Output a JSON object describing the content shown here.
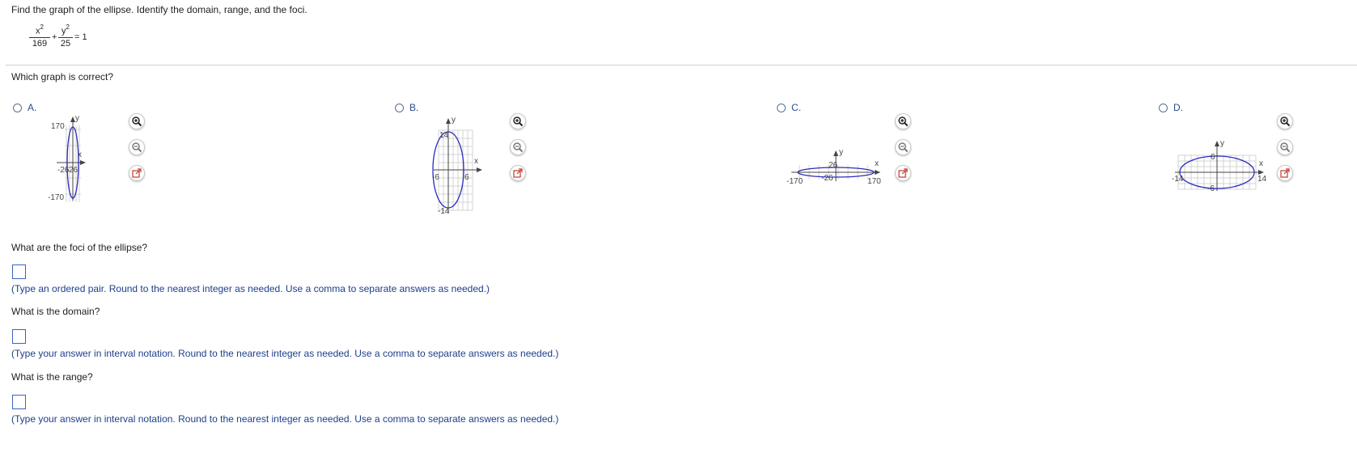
{
  "question": {
    "prompt": "Find the graph of the ellipse. Identify the domain, range, and the foci.",
    "equation": {
      "term1_num": "x",
      "term1_exp": "2",
      "term1_den": "169",
      "plus": "+",
      "term2_num": "y",
      "term2_exp": "2",
      "term2_den": "25",
      "rhs": "= 1"
    }
  },
  "graph_question": "Which graph is correct?",
  "options": [
    {
      "letter": "A.",
      "axis_x": "x",
      "axis_y": "y",
      "y_max_label": "170",
      "y_min_label": "-170",
      "x_left_label": "-26",
      "x_right_label": "26"
    },
    {
      "letter": "B.",
      "axis_x": "x",
      "axis_y": "y",
      "y_max_label": "14",
      "y_min_label": "-14",
      "x_left_label": "-6",
      "x_right_label": "6"
    },
    {
      "letter": "C.",
      "axis_x": "x",
      "axis_y": "y",
      "y_max_label": "26",
      "y_min_label": "-26",
      "x_left_label": "-170",
      "x_right_label": "170"
    },
    {
      "letter": "D.",
      "axis_x": "x",
      "axis_y": "y",
      "y_max_label": "6",
      "y_min_label": "-6",
      "x_left_label": "-14",
      "x_right_label": "14"
    }
  ],
  "tool_icons": [
    "zoom-in-icon",
    "zoom-out-icon",
    "open-external-icon"
  ],
  "foci": {
    "question": "What are the foci of the ellipse?",
    "answer_value": "",
    "hint": "(Type an ordered pair. Round to the nearest integer as needed. Use a comma to separate answers as needed.)"
  },
  "domain": {
    "question": "What is the domain?",
    "answer_value": "",
    "hint": "(Type your answer in interval notation. Round to the nearest integer as needed. Use a comma to separate answers as needed.)"
  },
  "range": {
    "question": "What is the range?",
    "answer_value": "",
    "hint": "(Type your answer in interval notation. Round to the nearest integer as needed. Use a comma to separate answers as needed.)"
  },
  "colors": {
    "ellipse": "#2b2bc0",
    "grid": "#c8c8c8",
    "axis": "#444444",
    "option_label": "#2a4b8d",
    "hint_text": "#1d3f8a",
    "answer_border": "#3b63c4"
  }
}
